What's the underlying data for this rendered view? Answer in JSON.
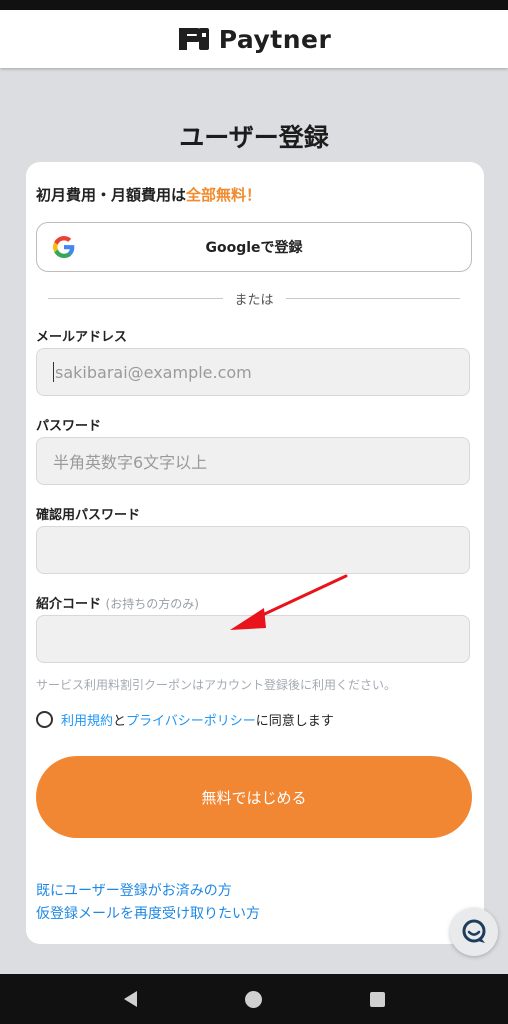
{
  "app": {
    "name": "Paytner"
  },
  "page": {
    "title": "ユーザー登録"
  },
  "promo": {
    "text": "初月費用・月額費用は",
    "accent": "全部無料！"
  },
  "google": {
    "label": "Googleで登録"
  },
  "divider": {
    "text": "または"
  },
  "form": {
    "email": {
      "label": "メールアドレス",
      "placeholder": "sakibarai@example.com",
      "value": ""
    },
    "password": {
      "label": "パスワード",
      "placeholder": "半角英数字6文字以上",
      "value": ""
    },
    "confirm_password": {
      "label": "確認用パスワード",
      "placeholder": "",
      "value": ""
    },
    "referral": {
      "label": "紹介コード",
      "hint": "(お持ちの方のみ)",
      "placeholder": "",
      "value": ""
    },
    "coupon_note": "サービス利用料割引クーポンはアカウント登録後に利用ください。"
  },
  "agreement": {
    "terms_link": "利用規約",
    "and": "と",
    "privacy_link": "プライバシーポリシー",
    "suffix": "に同意します"
  },
  "cta": {
    "label": "無料ではじめる"
  },
  "links": {
    "already_registered": "既にユーザー登録がお済みの方",
    "resend_email": "仮登録メールを再度受け取りたい方"
  },
  "colors": {
    "accent": "#f28733",
    "link": "#1e88e5",
    "annotation_arrow": "#e8131b"
  }
}
